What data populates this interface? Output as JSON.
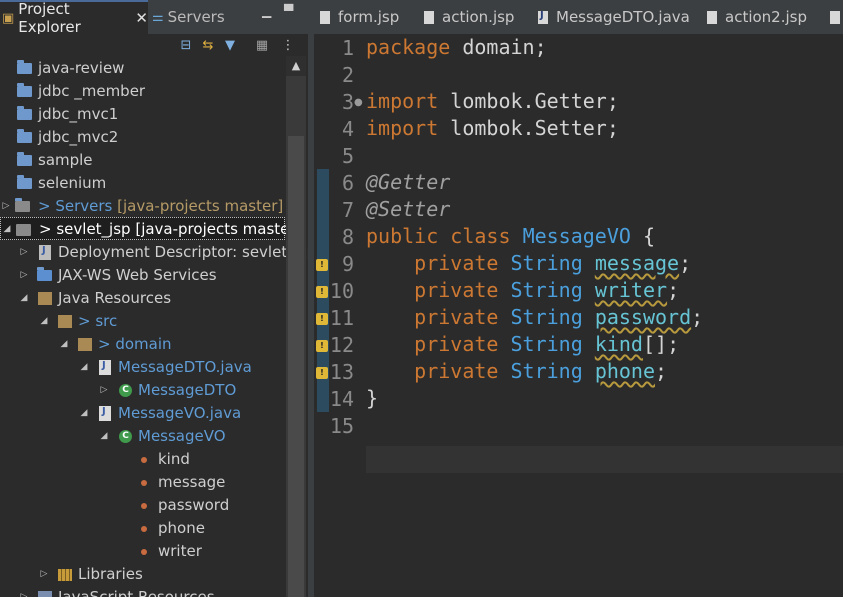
{
  "left_panel": {
    "tabs": {
      "project_explorer": "Project Explorer",
      "close": "✕",
      "servers": "Servers"
    },
    "tree": [
      {
        "label": "java-review"
      },
      {
        "label": "jdbc _member"
      },
      {
        "label": "jdbc_mvc1"
      },
      {
        "label": "jdbc_mvc2"
      },
      {
        "label": "sample"
      },
      {
        "label": "selenium"
      },
      {
        "prefix": ">",
        "label": "Servers",
        "suffix": "[java-projects master]"
      },
      {
        "prefix": ">",
        "label": "sevlet_jsp",
        "suffix": "[java-projects master]"
      },
      {
        "label": "Deployment Descriptor: sevlet_jsp"
      },
      {
        "label": "JAX-WS Web Services"
      },
      {
        "label": "Java Resources"
      },
      {
        "prefix": ">",
        "label": "src"
      },
      {
        "prefix": ">",
        "label": "domain"
      },
      {
        "label": "MessageDTO.java"
      },
      {
        "label": "MessageDTO"
      },
      {
        "label": "MessageVO.java"
      },
      {
        "label": "MessageVO"
      },
      {
        "label": "kind"
      },
      {
        "label": "message"
      },
      {
        "label": "password"
      },
      {
        "label": "phone"
      },
      {
        "label": "writer"
      },
      {
        "label": "Libraries"
      },
      {
        "label": "JavaScript Resources"
      }
    ]
  },
  "editor": {
    "tabs": [
      "form.jsp",
      "action.jsp",
      "MessageDTO.java",
      "action2.jsp"
    ],
    "line_numbers": [
      "1",
      "2",
      "3",
      "4",
      "5",
      "6",
      "7",
      "8",
      "9",
      "10",
      "11",
      "12",
      "13",
      "14",
      "15"
    ],
    "code": {
      "l1": {
        "kw": "package",
        "rest": " domain;"
      },
      "l3": {
        "kw": "import",
        "rest": " lombok.Getter;"
      },
      "l4": {
        "kw": "import",
        "rest": " lombok.Setter;"
      },
      "l6": "@Getter",
      "l7": "@Setter",
      "l8": {
        "kw1": "public",
        "kw2": "class",
        "type": "MessageVO",
        "rest": " {"
      },
      "fields": [
        {
          "kw": "private",
          "type": "String",
          "name": "message",
          "tail": ";"
        },
        {
          "kw": "private",
          "type": "String",
          "name": "writer",
          "tail": ";"
        },
        {
          "kw": "private",
          "type": "String",
          "name": "password",
          "tail": ";"
        },
        {
          "kw": "private",
          "type": "String",
          "name": "kind",
          "tail": "[];"
        },
        {
          "kw": "private",
          "type": "String",
          "name": "phone",
          "tail": ";"
        }
      ],
      "l14": "}"
    }
  },
  "colors": {
    "keyword": "#cc7832",
    "type": "#4a9fdc",
    "field": "#66c4d4",
    "annotation": "#a0a0a0",
    "background": "#2b2b2b"
  }
}
